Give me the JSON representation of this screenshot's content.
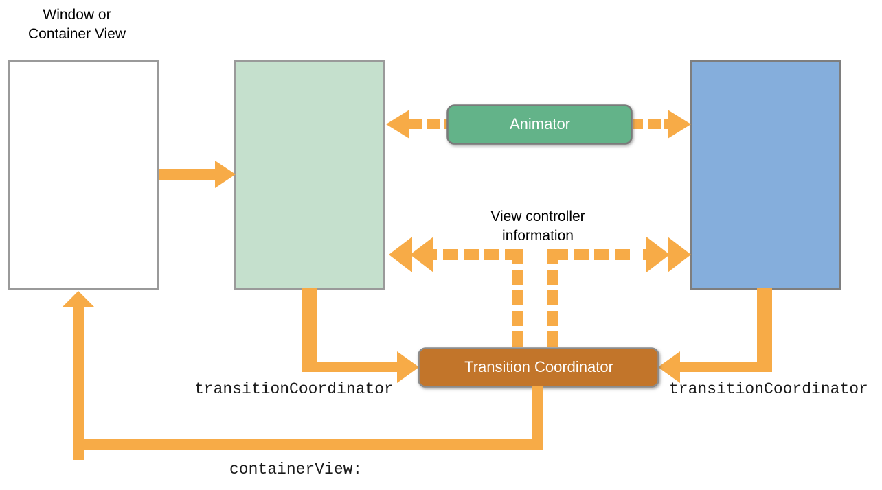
{
  "diagram": {
    "title_label": "Window or\nContainer View",
    "labels": {
      "view_controller_information": "View controller\ninformation",
      "transition_coordinator_left": "transitionCoordinator",
      "transition_coordinator_right": "transitionCoordinator",
      "container_view": "containerView:"
    },
    "nodes": [
      {
        "id": "window-container-view",
        "label": "",
        "shape": "rect",
        "fill": "#ffffff",
        "stroke": "#9a9a9a"
      },
      {
        "id": "from-view",
        "label": "",
        "shape": "rect",
        "fill": "#c5e0cd",
        "stroke": "#9a9a9a"
      },
      {
        "id": "to-view",
        "label": "",
        "shape": "rect",
        "fill": "#85aedc",
        "stroke": "#7e7e7e"
      },
      {
        "id": "animator",
        "label": "Animator",
        "shape": "rounded-rect",
        "fill": "#63b389",
        "stroke": "#7a7a7a"
      },
      {
        "id": "transition-coordinator",
        "label": "Transition Coordinator",
        "shape": "rounded-rect",
        "fill": "#c2752c",
        "stroke": "#8c8c8c"
      }
    ],
    "colors": {
      "arrow": "#f7ab47",
      "green_box": "#c5e0cd",
      "blue_box": "#85aedc",
      "animator_green": "#63b389",
      "coordinator_brown": "#c2752c",
      "box_border": "#9a9a9a",
      "text_dark": "#000000",
      "text_light": "#ffffff",
      "background": "#ffffff"
    },
    "connectors": [
      {
        "id": "window-to-fromview",
        "style": "solid",
        "direction": "right"
      },
      {
        "id": "animator-to-fromview",
        "style": "dashed",
        "direction": "left"
      },
      {
        "id": "animator-to-toview",
        "style": "dashed",
        "direction": "right"
      },
      {
        "id": "info-to-fromview",
        "style": "dashed",
        "direction": "left"
      },
      {
        "id": "info-to-toview",
        "style": "dashed",
        "direction": "right"
      },
      {
        "id": "coordinator-dashed-branch-left",
        "style": "dashed",
        "direction": "down"
      },
      {
        "id": "coordinator-dashed-branch-right",
        "style": "dashed",
        "direction": "down"
      },
      {
        "id": "fromview-to-coordinator",
        "style": "solid-elbow",
        "direction": "right"
      },
      {
        "id": "toview-to-coordinator",
        "style": "solid-elbow",
        "direction": "left"
      },
      {
        "id": "coordinator-to-window",
        "style": "solid-elbow",
        "direction": "up"
      }
    ]
  }
}
